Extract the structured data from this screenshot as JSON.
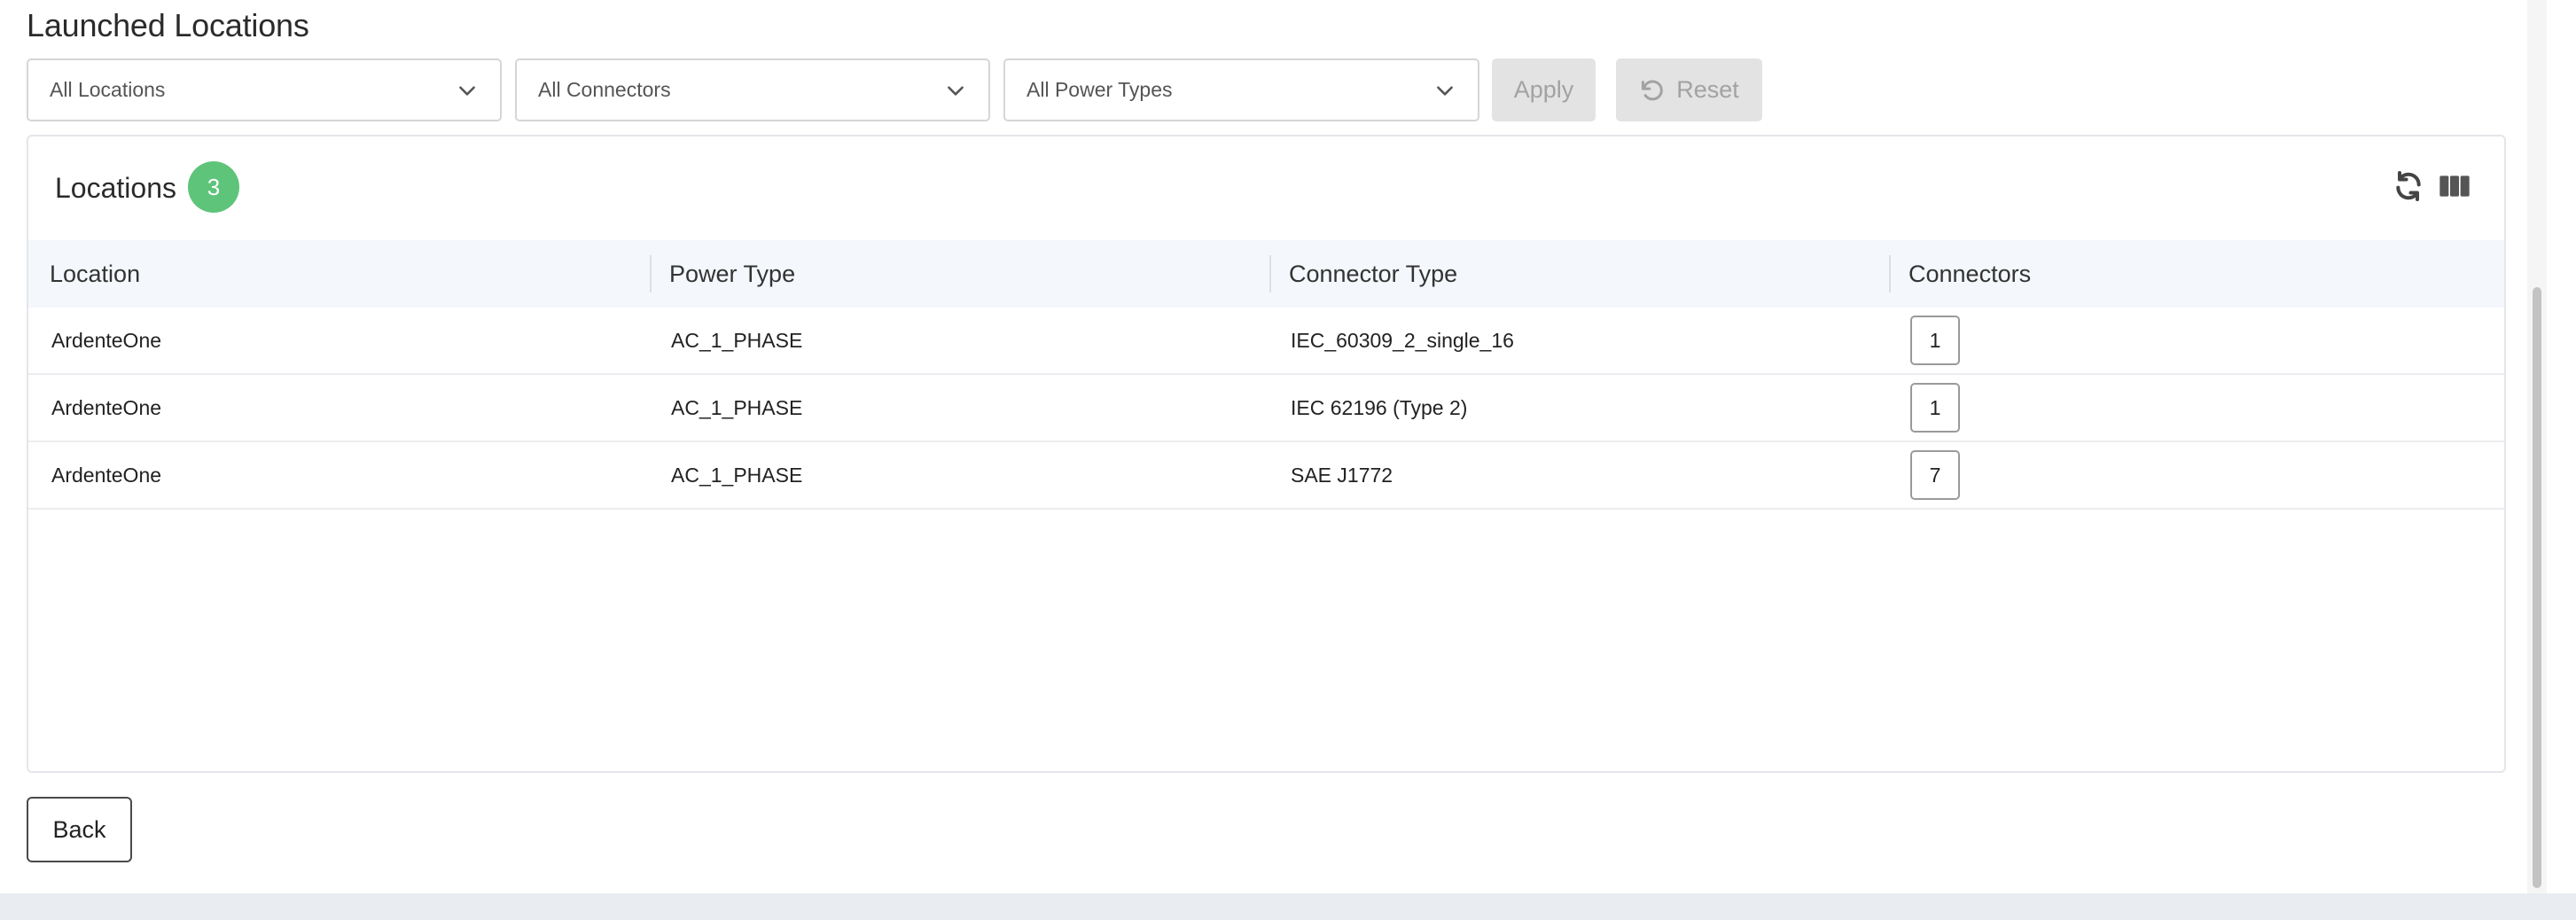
{
  "page": {
    "title": "Launched Locations"
  },
  "filters": {
    "locations": {
      "value": "All Locations"
    },
    "connectors": {
      "value": "All Connectors"
    },
    "power_types": {
      "value": "All Power Types"
    },
    "apply_label": "Apply",
    "reset_label": "Reset"
  },
  "card": {
    "title": "Locations",
    "count": "3",
    "tools": [
      "refresh-icon",
      "columns-icon"
    ]
  },
  "table": {
    "columns": [
      "Location",
      "Power Type",
      "Connector Type",
      "Connectors"
    ],
    "rows": [
      {
        "location": "ArdenteOne",
        "power_type": "AC_1_PHASE",
        "connector_type": "IEC_60309_2_single_16",
        "connectors": "1"
      },
      {
        "location": "ArdenteOne",
        "power_type": "AC_1_PHASE",
        "connector_type": "IEC 62196 (Type 2)",
        "connectors": "1"
      },
      {
        "location": "ArdenteOne",
        "power_type": "AC_1_PHASE",
        "connector_type": "SAE J1772",
        "connectors": "7"
      }
    ]
  },
  "footer": {
    "back_label": "Back"
  },
  "colors": {
    "badge": "#5ec47a",
    "header_bg": "#f4f7fb",
    "disabled_bg": "#e3e3e3"
  }
}
